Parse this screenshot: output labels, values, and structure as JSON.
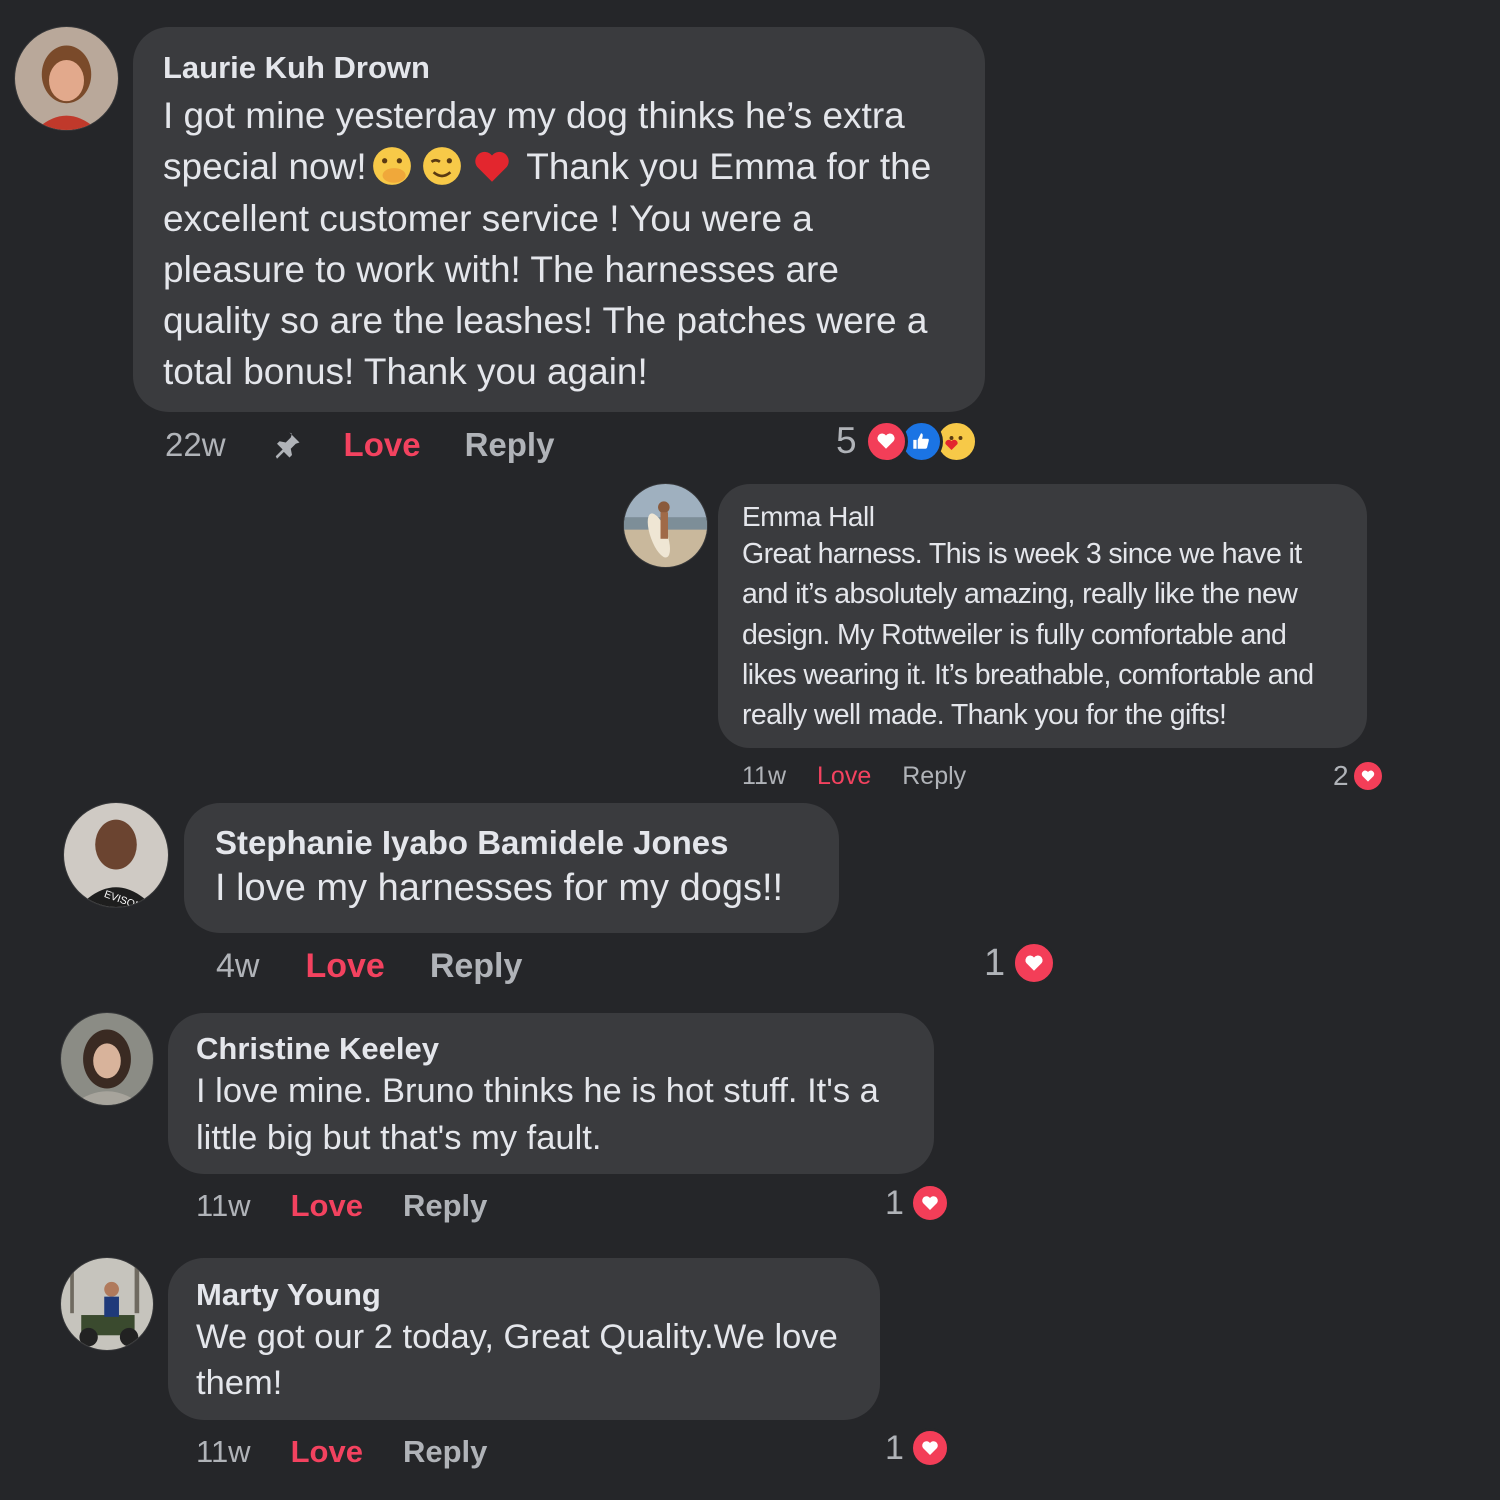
{
  "colors": {
    "background": "#252629",
    "bubble": "#3a3b3e",
    "love": "#f3425f",
    "meta_text": "#b0b3b8",
    "heart_badge": "#f33e58",
    "like_badge": "#1b74e4"
  },
  "comments": [
    {
      "author": "Laurie Kuh Drown",
      "text_part1": "I got mine yesterday my dog thinks he’s extra special now!",
      "emojis": [
        "face-with-hand-over-mouth-icon",
        "winking-face-icon",
        "red-heart-icon"
      ],
      "text_part2": " Thank you Emma for the excellent customer service ! You were a pleasure to work with! The harnesses are quality so are the leashes! The patches were a total bonus! Thank you again!",
      "time": "22w",
      "pinned_icon": "pin-icon",
      "love_label": "Love",
      "reply_label": "Reply",
      "reaction_count": "5",
      "reaction_icons": [
        "heart-reaction-icon",
        "like-reaction-icon",
        "care-reaction-icon"
      ]
    },
    {
      "author": "Emma Hall",
      "text": "Great harness. This is week 3 since we have it and it’s absolutely amazing, really like the new design. My Rottweiler is fully comfortable and likes wearing it. It’s breathable, comfortable and really well made. Thank you for the gifts!",
      "time": "11w",
      "love_label": "Love",
      "reply_label": "Reply",
      "reaction_count": "2",
      "reaction_icons": [
        "heart-reaction-icon"
      ]
    },
    {
      "author": "Stephanie Iyabo Bamidele Jones",
      "text": "I love my harnesses for my dogs!!",
      "time": "4w",
      "love_label": "Love",
      "reply_label": "Reply",
      "reaction_count": "1",
      "reaction_icons": [
        "heart-reaction-icon"
      ]
    },
    {
      "author": "Christine Keeley",
      "text": "I love mine. Bruno thinks he is hot stuff. It's a little big but that's my fault.",
      "time": "11w",
      "love_label": "Love",
      "reply_label": "Reply",
      "reaction_count": "1",
      "reaction_icons": [
        "heart-reaction-icon"
      ]
    },
    {
      "author": "Marty Young",
      "text": "We got our 2 today, Great Quality.We love them!",
      "time": "11w",
      "love_label": "Love",
      "reply_label": "Reply",
      "reaction_count": "1",
      "reaction_icons": [
        "heart-reaction-icon"
      ]
    }
  ]
}
